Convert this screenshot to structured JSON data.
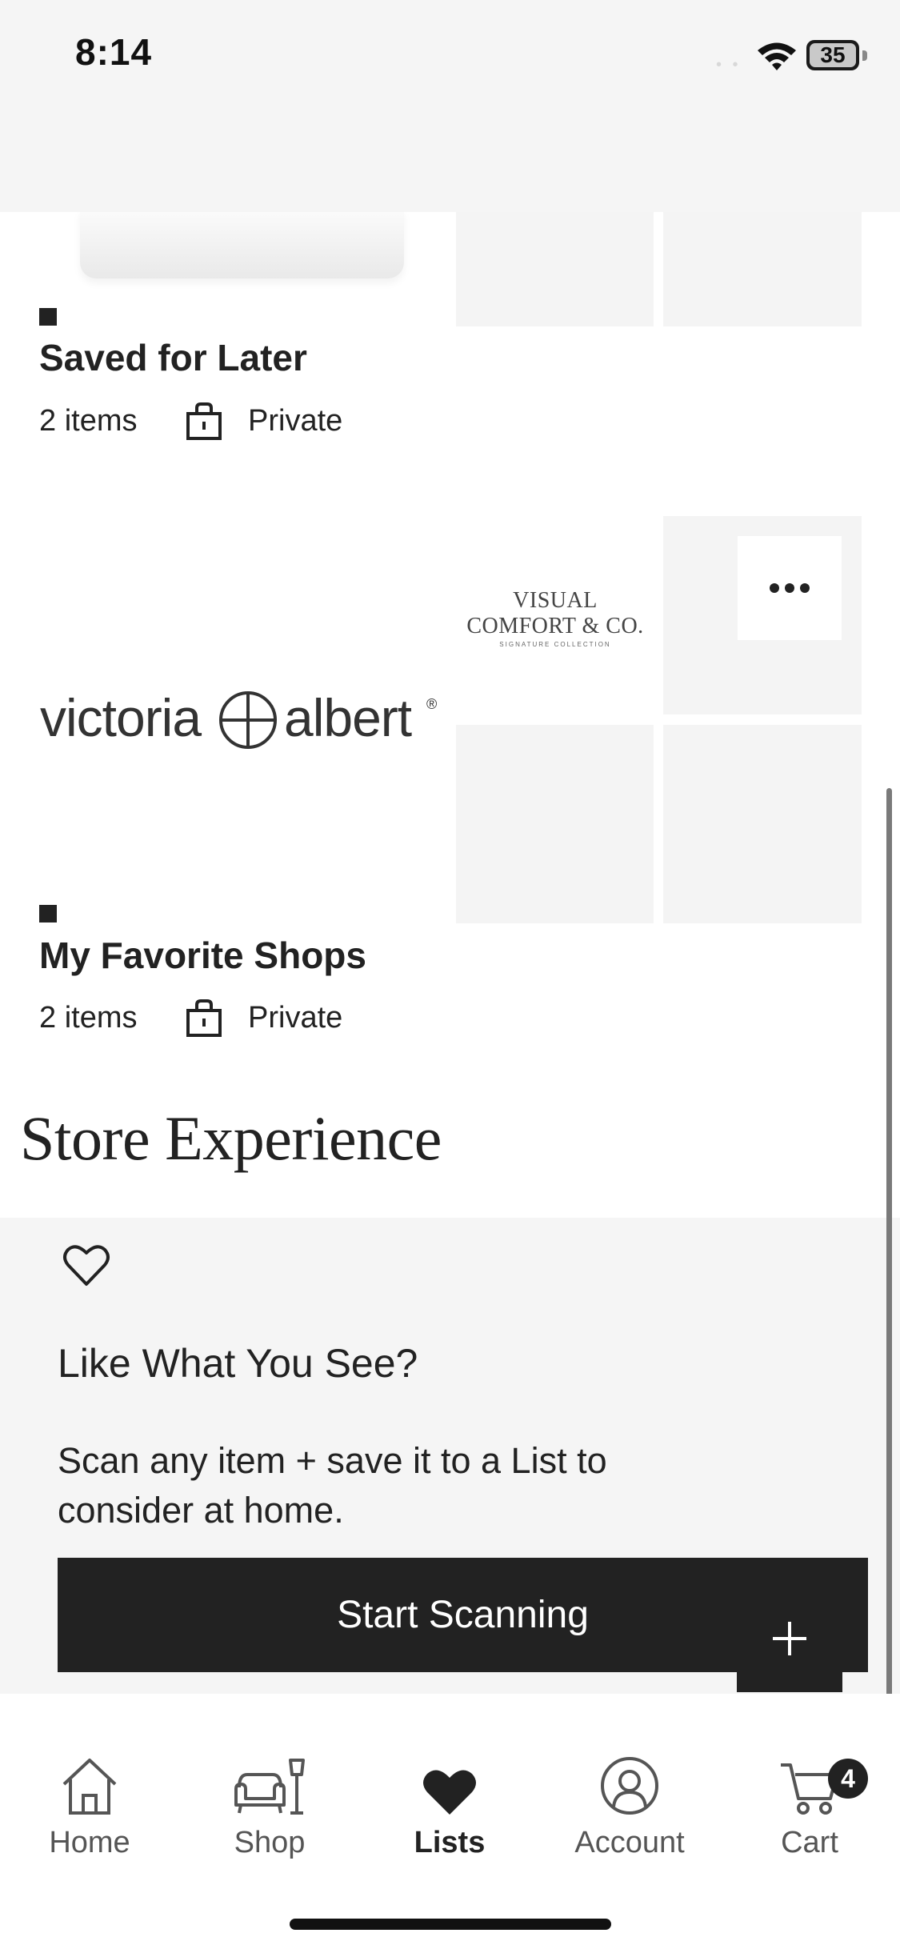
{
  "status_bar": {
    "time": "8:14",
    "battery": "35",
    "signal_dots": "• •"
  },
  "lists": [
    {
      "title": "Saved for Later",
      "count": "2 items",
      "privacy": "Private"
    },
    {
      "title": "My Favorite Shops",
      "count": "2 items",
      "privacy": "Private"
    }
  ],
  "logos": {
    "victoria_albert": "victoria ⊕ albert ®",
    "visual_comfort": "VISUAL COMFORT & CO.",
    "visual_comfort_sub": "SIGNATURE COLLECTION"
  },
  "store_experience": {
    "heading": "Store Experience",
    "card_title": "Like What You See?",
    "card_body": "Scan any item + save it to a List to consider at home.",
    "button_label": "Start Scanning",
    "plus_label": "+"
  },
  "tab_bar": {
    "tabs": [
      {
        "label": "Home",
        "icon": "house-icon"
      },
      {
        "label": "Shop",
        "icon": "armchair-lamp-icon"
      },
      {
        "label": "Lists",
        "icon": "heart-filled-icon",
        "active": true
      },
      {
        "label": "Account",
        "icon": "account-icon"
      },
      {
        "label": "Cart",
        "icon": "cart-icon"
      }
    ],
    "cart_count": "4"
  },
  "colors": {
    "primary": "#222222",
    "panel_bg": "#f5f5f5",
    "tile_bg": "#f4f4f4"
  }
}
